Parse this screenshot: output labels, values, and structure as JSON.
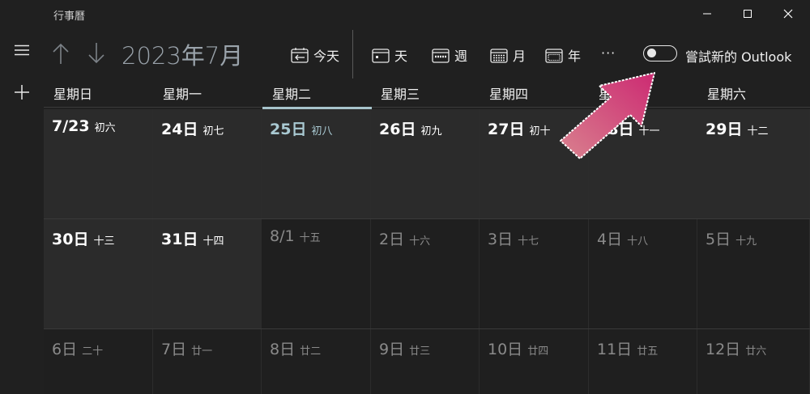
{
  "window": {
    "title": "行事曆"
  },
  "toolbar": {
    "month_title": "2023年7月",
    "today_label": "今天",
    "day_label": "天",
    "week_label": "週",
    "month_label": "月",
    "year_label": "年",
    "more_label": "···",
    "toggle_label": "嘗試新的 Outlook",
    "toggle_on": false
  },
  "weekdays": [
    "星期日",
    "星期一",
    "星期二",
    "星期三",
    "星期四",
    "星期五",
    "星期六"
  ],
  "weeks": [
    [
      {
        "date": "7/23",
        "lunar": "初六"
      },
      {
        "date": "24日",
        "lunar": "初七"
      },
      {
        "date": "25日",
        "lunar": "初八",
        "today": true
      },
      {
        "date": "26日",
        "lunar": "初九"
      },
      {
        "date": "27日",
        "lunar": "初十"
      },
      {
        "date": "28日",
        "lunar": "十一"
      },
      {
        "date": "29日",
        "lunar": "十二"
      }
    ],
    [
      {
        "date": "30日",
        "lunar": "十三"
      },
      {
        "date": "31日",
        "lunar": "十四"
      },
      {
        "date": "8/1",
        "lunar": "十五",
        "other": true
      },
      {
        "date": "2日",
        "lunar": "十六",
        "other": true
      },
      {
        "date": "3日",
        "lunar": "十七",
        "other": true
      },
      {
        "date": "4日",
        "lunar": "十八",
        "other": true
      },
      {
        "date": "5日",
        "lunar": "十九",
        "other": true
      }
    ],
    [
      {
        "date": "6日",
        "lunar": "二十",
        "other": true
      },
      {
        "date": "7日",
        "lunar": "廿一",
        "other": true
      },
      {
        "date": "8日",
        "lunar": "廿二",
        "other": true
      },
      {
        "date": "9日",
        "lunar": "廿三",
        "other": true
      },
      {
        "date": "10日",
        "lunar": "廿四",
        "other": true
      },
      {
        "date": "11日",
        "lunar": "廿五",
        "other": true
      },
      {
        "date": "12日",
        "lunar": "廿六",
        "other": true
      }
    ]
  ],
  "colors": {
    "background": "#202020",
    "accent_today": "#a9c9d2",
    "annotation_arrow": "#d23f7f"
  },
  "icons": {
    "menu": "hamburger-icon",
    "add": "plus-icon",
    "up": "arrow-up-icon",
    "down": "arrow-down-icon"
  }
}
